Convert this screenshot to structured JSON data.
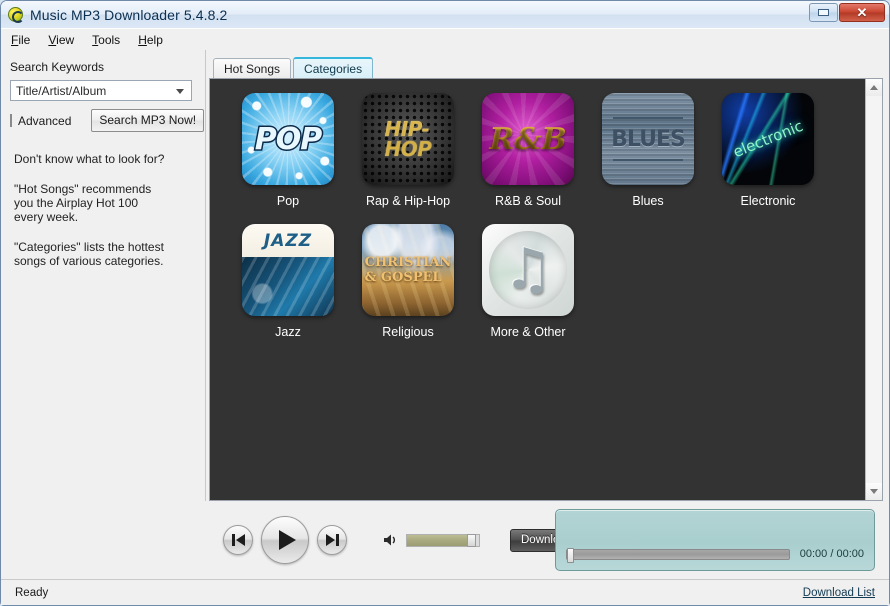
{
  "window": {
    "title": "Music MP3 Downloader  5.4.8.2",
    "app_icon": "disc-icon",
    "minimize_label": "–",
    "close_label": "✕"
  },
  "menubar": {
    "items": [
      {
        "label": "File",
        "accel": "F"
      },
      {
        "label": "View",
        "accel": "V"
      },
      {
        "label": "Tools",
        "accel": "T"
      },
      {
        "label": "Help",
        "accel": "H"
      }
    ]
  },
  "sidebar": {
    "search_label": "Search Keywords",
    "keyword_value": "Title/Artist/Album",
    "keyword_placeholder": "Title/Artist/Album",
    "dropdown_icon": "chevron-down-icon",
    "advanced_label": "Advanced",
    "advanced_checked": false,
    "search_button": "Search MP3 Now!",
    "help_line_1": "Don't know what to look for?",
    "help_line_2": "\"Hot Songs\" recommends\nyou the Airplay Hot 100\nevery week.",
    "help_line_3": "\"Categories\" lists the hottest\nsongs of various categories."
  },
  "tabs": [
    {
      "label": "Hot Songs",
      "active": false
    },
    {
      "label": "Categories",
      "active": true
    }
  ],
  "categories": [
    {
      "label": "Pop",
      "art": "pop",
      "art_text": "POP"
    },
    {
      "label": "Rap & Hip-Hop",
      "art": "hiphop",
      "art_text": "HIP-\nHOP"
    },
    {
      "label": "R&B & Soul",
      "art": "rnb",
      "art_text": "R&B"
    },
    {
      "label": "Blues",
      "art": "blues",
      "art_text": "BLUES"
    },
    {
      "label": "Electronic",
      "art": "electronic",
      "art_text": "electronic"
    },
    {
      "label": "Jazz",
      "art": "jazz",
      "art_text": "JAZZ"
    },
    {
      "label": "Religious",
      "art": "religious",
      "art_text": "CHRISTIAN\n& GOSPEL"
    },
    {
      "label": "More & Other",
      "art": "more",
      "art_text": "♫"
    }
  ],
  "scrollbar": {
    "up_icon": "scroll-up-arrow-icon",
    "down_icon": "scroll-down-arrow-icon"
  },
  "player": {
    "previous_icon": "previous-track-icon",
    "play_icon": "play-icon",
    "next_icon": "next-track-icon",
    "speaker_icon": "speaker-icon",
    "volume_percent": 83,
    "download_button": "Download",
    "seek_percent": 0,
    "time_display": "00:00 / 00:00"
  },
  "statusbar": {
    "status": "Ready",
    "download_list_link": "Download List"
  },
  "colors": {
    "content_background": "#333333",
    "active_tab_accent": "#35b7dd",
    "lcd_panel": "#b3d4d4",
    "volume_fill": "#a8a97e",
    "close_button": "#c9452f"
  }
}
